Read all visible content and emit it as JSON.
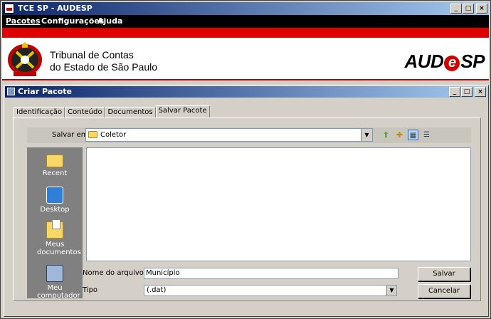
{
  "app": {
    "title": "TCE SP - AUDESP",
    "controls": {
      "minimize": "_",
      "maximize": "□",
      "close": "×"
    }
  },
  "menu": [
    "Pacotes",
    "Configurações",
    "Ajuda"
  ],
  "header": {
    "org_line1": "Tribunal de Contas",
    "org_line2": "do Estado de São Paulo",
    "brand_left": "AUD",
    "brand_e": "e",
    "brand_right": "SP",
    "accent_color": "#e00000"
  },
  "dialog": {
    "title": "Criar Pacote",
    "tabs": [
      "Identificação",
      "Conteúdo",
      "Documentos",
      "Salvar Pacote"
    ],
    "active_tab": "Salvar Pacote"
  },
  "save": {
    "save_in_label": "Salvar em",
    "save_in_value": "Coletor",
    "toolbar_icons": [
      "up-folder-icon",
      "new-folder-icon",
      "list-view-icon",
      "details-view-icon"
    ],
    "places": [
      {
        "label": "Recent",
        "icon": "recent-folder-icon"
      },
      {
        "label": "Desktop",
        "icon": "desktop-icon"
      },
      {
        "label": "Meus documentos",
        "icon": "my-documents-icon"
      },
      {
        "label": "Meu computador",
        "icon": "my-computer-icon"
      }
    ],
    "file_name_label": "Nome do arquivo",
    "file_name_value": "Município",
    "file_type_label": "Tipo",
    "file_type_value": "(.dat)",
    "save_button": "Salvar",
    "cancel_button": "Cancelar"
  }
}
